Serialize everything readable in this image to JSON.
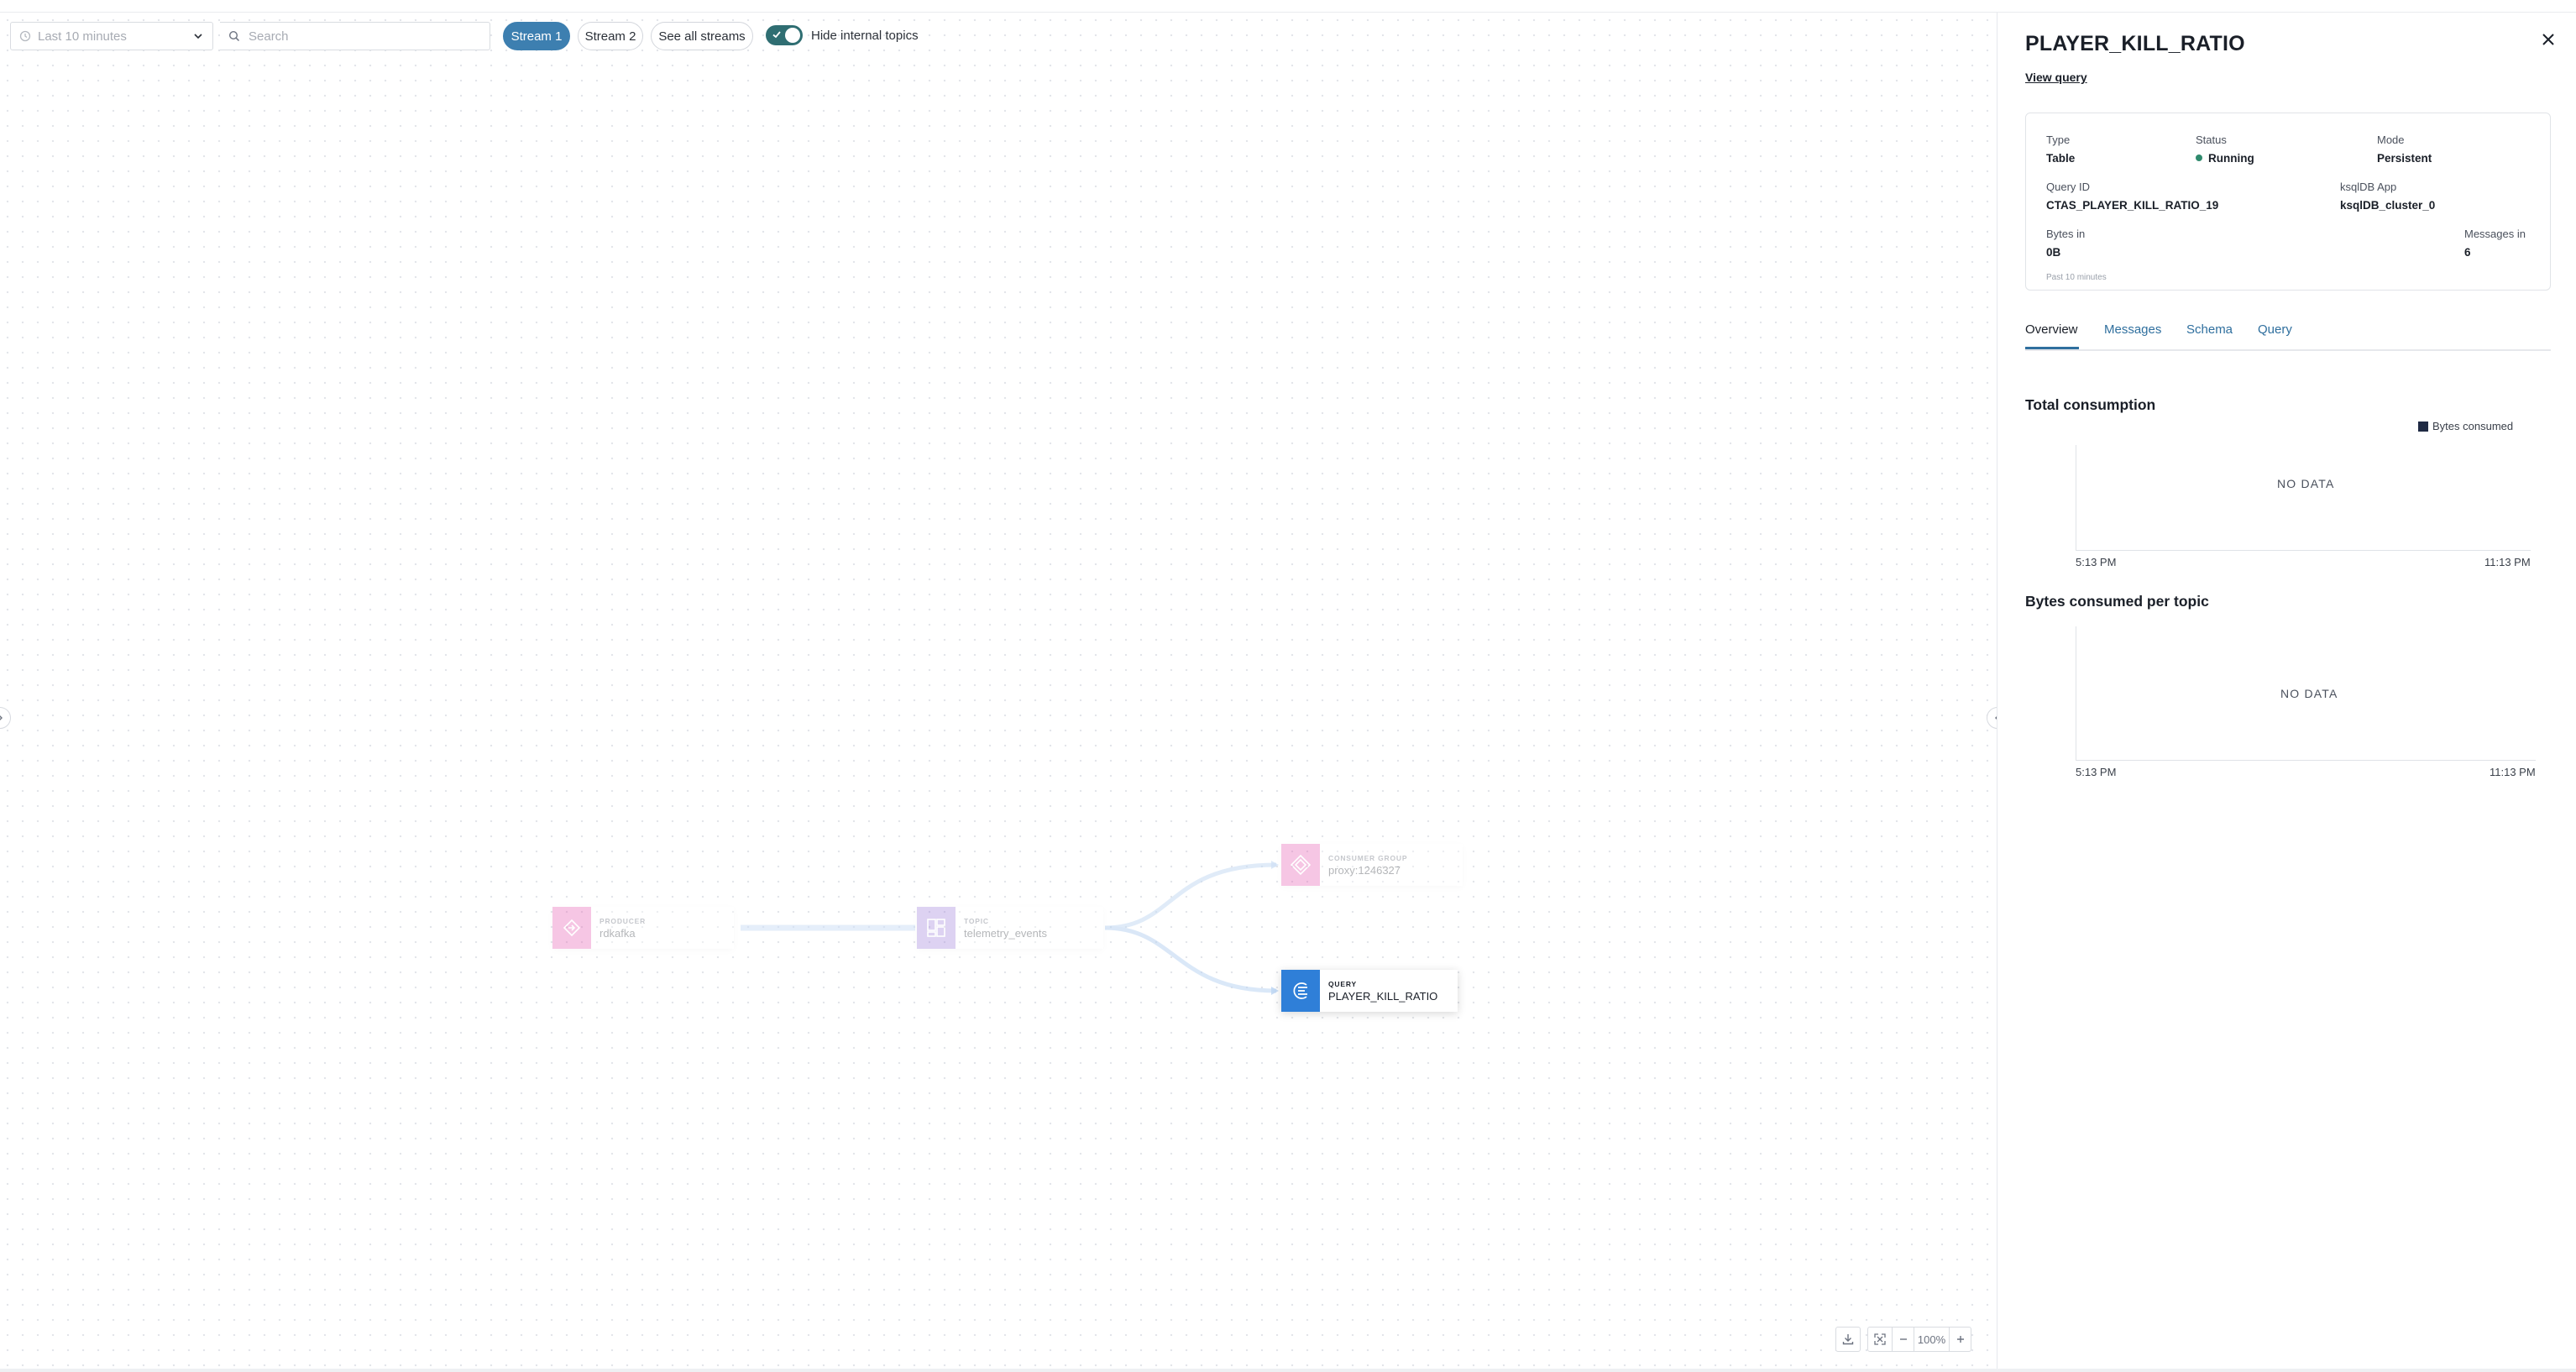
{
  "toolbar": {
    "time_range": "Last 10 minutes",
    "search_placeholder": "Search",
    "stream_buttons": [
      "Stream 1",
      "Stream 2"
    ],
    "active_stream": "Stream 1",
    "see_all_label": "See all streams",
    "hide_internal_label": "Hide internal topics",
    "hide_internal_on": true
  },
  "graph": {
    "nodes": [
      {
        "type": "PRODUCER",
        "name": "rdkafka",
        "icon": "producer-icon",
        "color": "#e65fb3",
        "faded": true
      },
      {
        "type": "TOPIC",
        "name": "telemetry_events",
        "icon": "topic-icon",
        "color": "#9f7fdc",
        "faded": true
      },
      {
        "type": "CONSUMER GROUP",
        "name": "proxy:1246327",
        "icon": "consumer-group-icon",
        "color": "#e65fb3",
        "faded": true
      },
      {
        "type": "QUERY",
        "name": "PLAYER_KILL_RATIO",
        "icon": "query-icon",
        "color": "#2f7fd8",
        "faded": false
      }
    ]
  },
  "zoom": {
    "level": "100%"
  },
  "panel": {
    "title": "PLAYER_KILL_RATIO",
    "view_query_label": "View query",
    "info": {
      "type_label": "Type",
      "type_value": "Table",
      "status_label": "Status",
      "status_value": "Running",
      "mode_label": "Mode",
      "mode_value": "Persistent",
      "query_id_label": "Query ID",
      "query_id_value": "CTAS_PLAYER_KILL_RATIO_19",
      "app_label": "ksqlDB App",
      "app_value": "ksqlDB_cluster_0",
      "bytes_in_label": "Bytes in",
      "bytes_in_value": "0B",
      "messages_in_label": "Messages in",
      "messages_in_value": "6",
      "footnote": "Past 10 minutes"
    },
    "tabs": [
      "Overview",
      "Messages",
      "Schema",
      "Query"
    ],
    "active_tab": "Overview",
    "total_consumption": {
      "title": "Total consumption",
      "legend": "Bytes consumed",
      "empty_text": "NO DATA",
      "x_start": "5:13 PM",
      "x_end": "11:13 PM"
    },
    "per_topic": {
      "title": "Bytes consumed per topic",
      "empty_text": "NO DATA",
      "x_start": "5:13 PM",
      "x_end": "11:13 PM"
    }
  },
  "colors": {
    "accent": "#3d7fb0",
    "toggle": "#2f6e72",
    "status_running": "#2f8a6d",
    "legend": "#1f2a44"
  }
}
